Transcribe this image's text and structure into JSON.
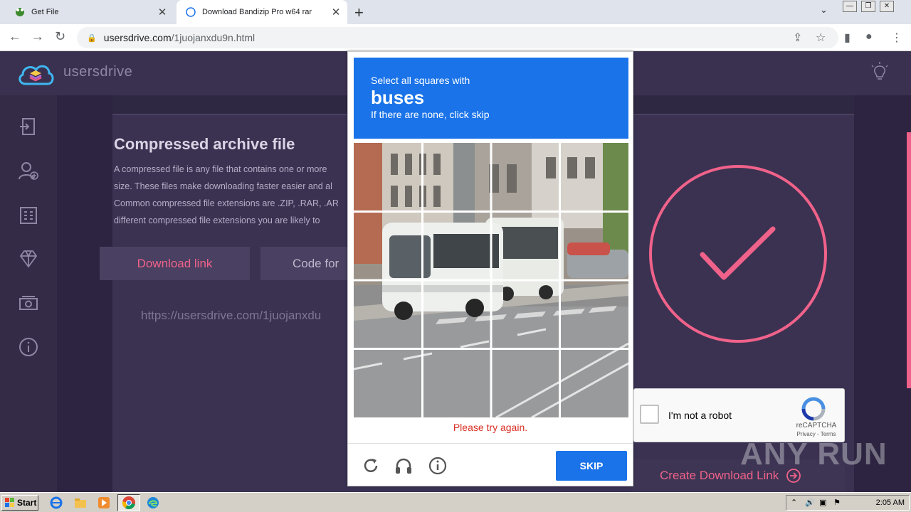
{
  "browser": {
    "tabs": [
      {
        "title": "Get File",
        "active": false
      },
      {
        "title": "Download Bandizip Pro w64 rar",
        "active": true
      }
    ],
    "new_tab_label": "+",
    "address": {
      "host": "usersdrive.com",
      "path": "/1juojanxdu9n.html"
    }
  },
  "site": {
    "name": "usersdrive",
    "heading": "Compressed archive file",
    "paragraph_lines": [
      "A compressed file is any file that contains one or more",
      "size. These files make downloading faster easier and al",
      "Common compressed file extensions are .ZIP, .RAR, .AR",
      "different compressed file extensions you are likely to"
    ],
    "tab_download": "Download link",
    "tab_code": "Code for",
    "link_url": "https://usersdrive.com/1juojanxdu",
    "create_button": "Create Download Link",
    "accent": "#f0628a"
  },
  "captcha": {
    "instruction": "Select all squares with",
    "target": "buses",
    "hint": "If there are none, click skip",
    "error": "Please try again.",
    "skip_label": "SKIP",
    "accent": "#1a73e8"
  },
  "recaptcha_widget": {
    "label": "I'm not a robot",
    "brand": "reCAPTCHA",
    "terms": "Privacy - Terms"
  },
  "watermark": "ANY RUN",
  "taskbar": {
    "start_label": "Start",
    "clock": "2:05 AM"
  }
}
